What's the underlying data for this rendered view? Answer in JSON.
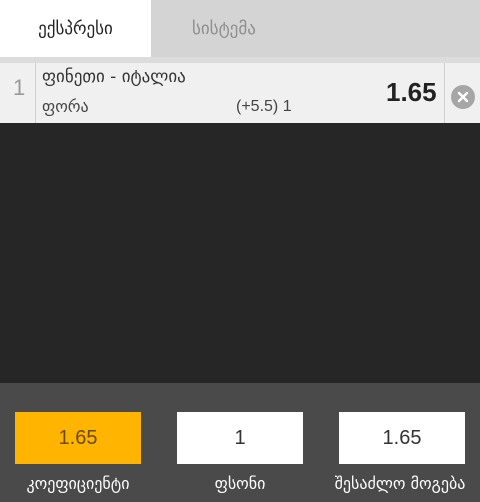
{
  "tabs": [
    {
      "label": "ექსპრესი",
      "active": true
    },
    {
      "label": "სისტემა",
      "active": false
    }
  ],
  "bet": {
    "index": "1",
    "match": "ფინეთი - იტალია",
    "market": "ფორა",
    "selection": "(+5.5) 1",
    "odds": "1.65",
    "remove_icon": "close-circle-icon"
  },
  "footer": {
    "odds_value": "1.65",
    "odds_label": "კოეფიციენტი",
    "stake_value": "1",
    "stake_label": "ფსონი",
    "win_value": "1.65",
    "win_label": "შესაძლო მოგება"
  },
  "colors": {
    "accent": "#ffb400",
    "background": "#262626",
    "footer": "#4a4a4a"
  }
}
